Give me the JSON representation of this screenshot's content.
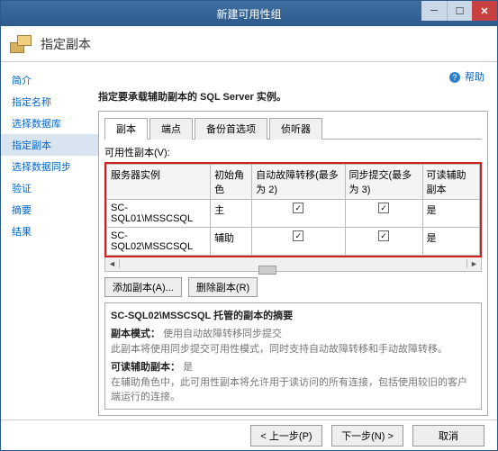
{
  "titlebar": {
    "title": "新建可用性组"
  },
  "header": {
    "title": "指定副本"
  },
  "sidebar": {
    "items": [
      {
        "label": "简介"
      },
      {
        "label": "指定名称"
      },
      {
        "label": "选择数据库"
      },
      {
        "label": "指定副本",
        "active": true
      },
      {
        "label": "选择数据同步"
      },
      {
        "label": "验证"
      },
      {
        "label": "摘要"
      },
      {
        "label": "结果"
      }
    ]
  },
  "help": {
    "label": "帮助"
  },
  "instruction": "指定要承载辅助副本的 SQL Server 实例。",
  "tabs": [
    {
      "label": "副本",
      "active": true
    },
    {
      "label": "端点"
    },
    {
      "label": "备份首选项"
    },
    {
      "label": "侦听器"
    }
  ],
  "table": {
    "title": "可用性副本(V):",
    "headers": [
      "服务器实例",
      "初始角色",
      "自动故障转移(最多为 2)",
      "同步提交(最多为 3)",
      "可读辅助副本"
    ],
    "rows": [
      {
        "server": "SC-SQL01\\MSSCSQL",
        "role": "主",
        "autofail": true,
        "sync": true,
        "readable": "是"
      },
      {
        "server": "SC-SQL02\\MSSCSQL",
        "role": "辅助",
        "autofail": true,
        "sync": true,
        "readable": "是"
      }
    ]
  },
  "buttons": {
    "add": "添加副本(A)...",
    "remove": "删除副本(R)"
  },
  "summary": {
    "title": "SC-SQL02\\MSSCSQL 托管的副本的摘要",
    "mode_label": "副本模式：",
    "mode_value": "使用自动故障转移同步提交",
    "mode_desc": "此副本将使用同步提交可用性模式，同时支持自动故障转移和手动故障转移。",
    "readable_label": "可读辅助副本：",
    "readable_value": "是",
    "readable_desc": "在辅助角色中，此可用性副本将允许用于读访问的所有连接，包括使用较旧的客户端运行的连接。"
  },
  "footer": {
    "prev": "< 上一步(P)",
    "next": "下一步(N) >",
    "cancel": "取消"
  }
}
